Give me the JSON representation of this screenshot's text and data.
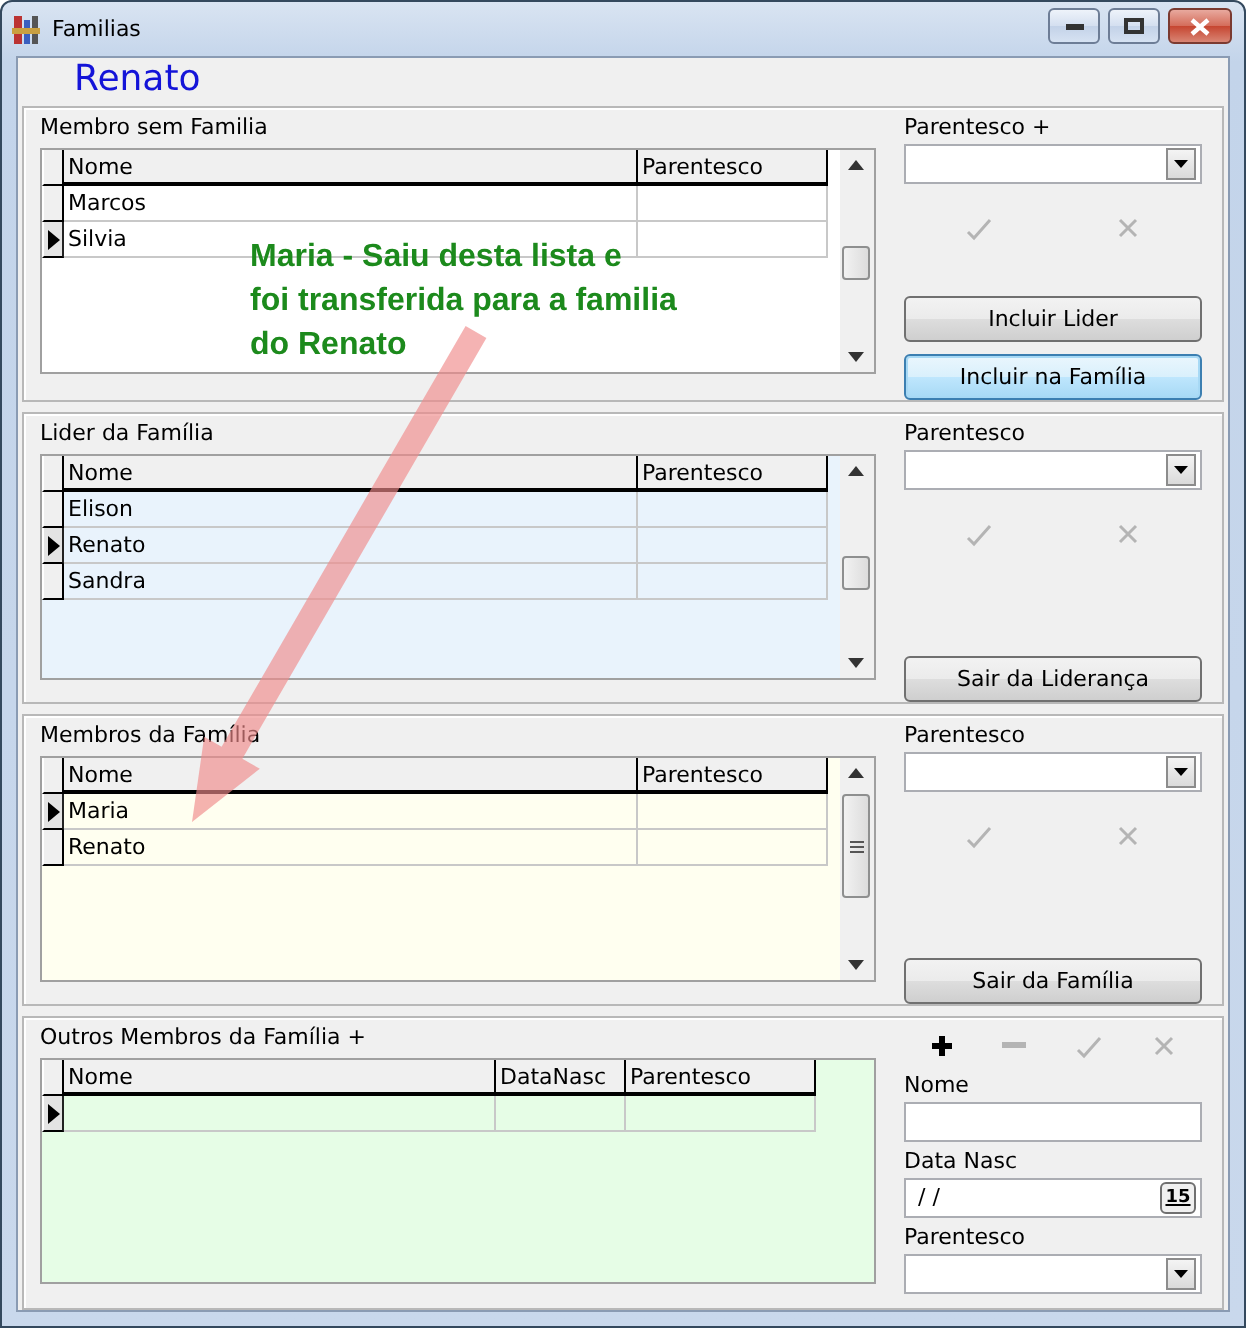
{
  "window": {
    "title": "Familias"
  },
  "heading": "Renato",
  "annotation": {
    "text": "Maria - Saiu desta lista e\nfoi transferida para a familia\ndo Renato"
  },
  "sections": [
    {
      "kind": "list",
      "title": "Membro sem Familia",
      "columns": [
        "Nome",
        "Parentesco"
      ],
      "rows": [
        {
          "nome": "Marcos",
          "selected": false
        },
        {
          "nome": "Silvia",
          "selected": true
        }
      ],
      "side": {
        "fields": [
          {
            "kind": "combo",
            "label": "Parentesco +"
          }
        ],
        "tools": [
          {
            "kind": "confirm",
            "disabled": true
          },
          {
            "kind": "cancel",
            "disabled": true
          }
        ],
        "buttons": [
          {
            "label": "Incluir Lider",
            "focused": false
          },
          {
            "label": "Incluir na Família",
            "focused": true
          }
        ]
      }
    },
    {
      "kind": "list",
      "title": "Lider da Família",
      "columns": [
        "Nome",
        "Parentesco"
      ],
      "rows": [
        {
          "nome": "Elison",
          "selected": false
        },
        {
          "nome": "Renato",
          "selected": true
        },
        {
          "nome": "Sandra",
          "selected": false
        }
      ],
      "side": {
        "fields": [
          {
            "kind": "combo",
            "label": "Parentesco"
          }
        ],
        "tools": [
          {
            "kind": "confirm",
            "disabled": true
          },
          {
            "kind": "cancel",
            "disabled": true
          }
        ],
        "buttons": [
          {
            "label": "Sair da Liderança",
            "focused": false
          }
        ]
      }
    },
    {
      "kind": "list",
      "title": "Membros da Família",
      "columns": [
        "Nome",
        "Parentesco"
      ],
      "rows": [
        {
          "nome": "Maria",
          "selected": true
        },
        {
          "nome": "Renato",
          "selected": false
        }
      ],
      "side": {
        "fields": [
          {
            "kind": "combo",
            "label": "Parentesco"
          }
        ],
        "tools": [
          {
            "kind": "confirm",
            "disabled": true
          },
          {
            "kind": "cancel",
            "disabled": true
          }
        ],
        "buttons": [
          {
            "label": "Sair da Família",
            "focused": false
          }
        ]
      }
    },
    {
      "kind": "form",
      "title": "Outros Membros da Família +",
      "columns": [
        "Nome",
        "DataNasc",
        "Parentesco"
      ],
      "rows": [
        {
          "selected": true
        }
      ],
      "side": {
        "tools": [
          {
            "kind": "add",
            "disabled": false
          },
          {
            "kind": "remove",
            "disabled": true
          },
          {
            "kind": "confirm",
            "disabled": true
          },
          {
            "kind": "cancel",
            "disabled": true
          }
        ],
        "fields": [
          {
            "kind": "text",
            "label": "Nome"
          },
          {
            "kind": "date",
            "label": "Data Nasc",
            "value": "/ /",
            "calendar": "15"
          },
          {
            "kind": "combo",
            "label": "Parentesco"
          }
        ]
      }
    }
  ]
}
